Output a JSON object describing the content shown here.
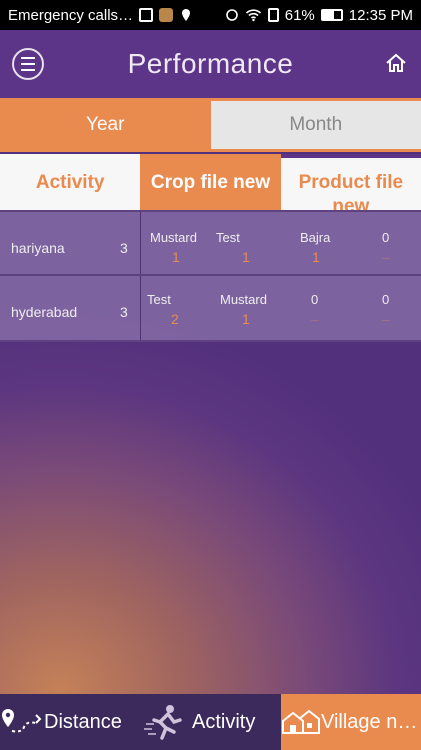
{
  "status_bar": {
    "carrier_text": "Emergency calls…",
    "battery": "61%",
    "time": "12:35 PM"
  },
  "header": {
    "title": "Performance",
    "menu_icon": "hamburger-menu-icon",
    "home_icon": "home-icon"
  },
  "period_tabs": {
    "year": "Year",
    "month": "Month",
    "selected": "Year"
  },
  "category_tabs": {
    "activity": "Activity",
    "crop_file_new": "Crop file new",
    "product_file_new": "Product file new",
    "selected": "Crop file new"
  },
  "rows": [
    {
      "location": "hariyana",
      "count": "3",
      "items": [
        {
          "name": "Mustard",
          "value": "1"
        },
        {
          "name": "Test",
          "value": "1"
        },
        {
          "name": "Bajra",
          "value": "1"
        },
        {
          "name": "0",
          "value": "–"
        }
      ]
    },
    {
      "location": "hyderabad",
      "count": "3",
      "items": [
        {
          "name": "Test",
          "value": "2"
        },
        {
          "name": "Mustard",
          "value": "1"
        },
        {
          "name": "0",
          "value": "–"
        },
        {
          "name": "0",
          "value": "–"
        }
      ]
    }
  ],
  "bottom_nav": {
    "distance": "Distance",
    "activity": "Activity",
    "village": "Village n…",
    "selected": "Village n…"
  },
  "colors": {
    "accent": "#e98a4f",
    "header_purple": "#5c3488",
    "nav_dark": "#3c2a5c"
  }
}
